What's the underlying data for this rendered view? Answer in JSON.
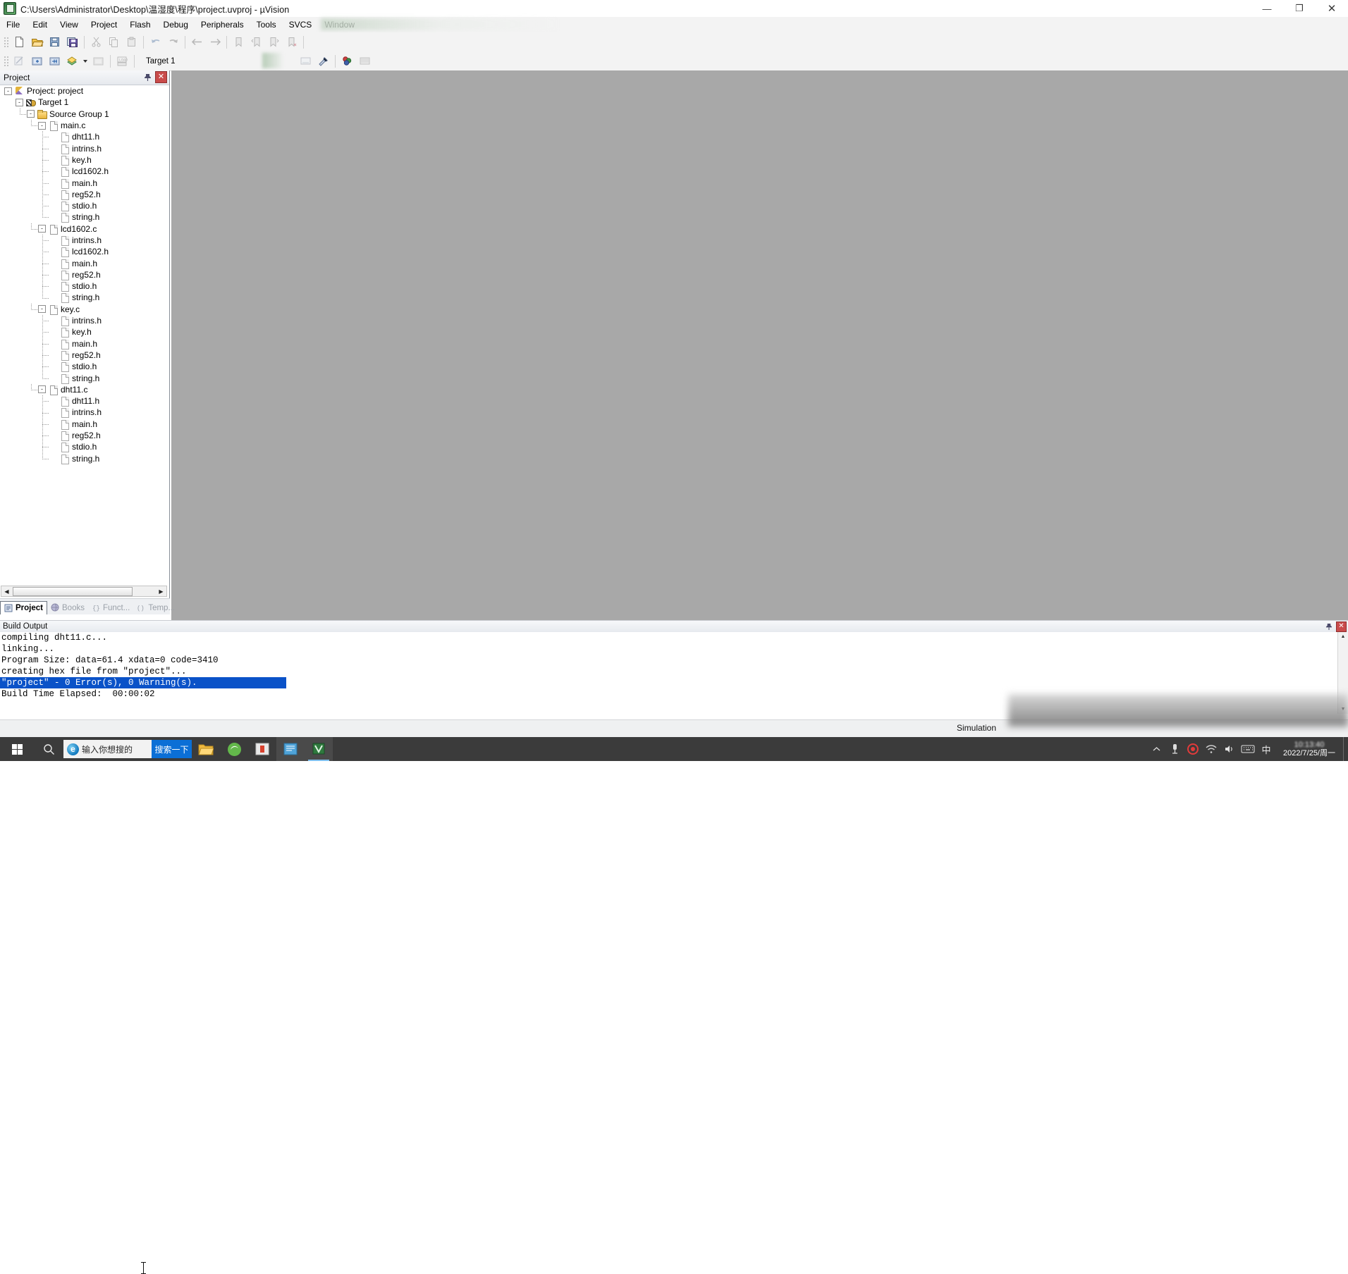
{
  "window": {
    "title": "C:\\Users\\Administrator\\Desktop\\温湿度\\程序\\project.uvproj - µVision",
    "app_icon": "keil-uvision-icon",
    "controls": {
      "minimize": "—",
      "maximize": "❐",
      "close": "✕"
    }
  },
  "menubar": {
    "items": [
      {
        "label": "File"
      },
      {
        "label": "Edit"
      },
      {
        "label": "View"
      },
      {
        "label": "Project"
      },
      {
        "label": "Flash"
      },
      {
        "label": "Debug"
      },
      {
        "label": "Peripherals"
      },
      {
        "label": "Tools"
      },
      {
        "label": "SVCS"
      },
      {
        "label": "Window"
      }
    ]
  },
  "toolbar_file": {
    "buttons": [
      {
        "name": "new-file-icon",
        "title": "New"
      },
      {
        "name": "open-file-icon",
        "title": "Open"
      },
      {
        "name": "save-icon",
        "title": "Save"
      },
      {
        "name": "save-all-icon",
        "title": "Save All"
      },
      {
        "name": "cut-icon",
        "title": "Cut"
      },
      {
        "name": "copy-icon",
        "title": "Copy"
      },
      {
        "name": "paste-icon",
        "title": "Paste"
      },
      {
        "name": "undo-icon",
        "title": "Undo"
      },
      {
        "name": "redo-icon",
        "title": "Redo"
      },
      {
        "name": "navigate-back-icon",
        "title": "Back"
      },
      {
        "name": "navigate-forward-icon",
        "title": "Forward"
      },
      {
        "name": "bookmark-toggle-icon",
        "title": "Insert/Remove Bookmark"
      },
      {
        "name": "bookmark-prev-icon",
        "title": "Previous Bookmark"
      },
      {
        "name": "bookmark-next-icon",
        "title": "Next Bookmark"
      },
      {
        "name": "bookmark-clear-icon",
        "title": "Clear All Bookmarks"
      }
    ]
  },
  "toolbar_build": {
    "buttons": [
      {
        "name": "translate-icon",
        "title": "Translate"
      },
      {
        "name": "build-icon",
        "title": "Build"
      },
      {
        "name": "rebuild-icon",
        "title": "Rebuild"
      },
      {
        "name": "batch-build-icon",
        "title": "Batch Build"
      },
      {
        "name": "stop-build-icon",
        "title": "Stop Build"
      },
      {
        "name": "download-icon",
        "title": "Download"
      }
    ],
    "target_label": "Target 1",
    "right_buttons": [
      {
        "name": "target-options-icon",
        "title": "Options for Target"
      },
      {
        "name": "configure-icon",
        "title": "Configuration Wizard"
      },
      {
        "name": "manage-components-icon",
        "title": "Manage Project Items"
      },
      {
        "name": "books-icon",
        "title": "Books"
      }
    ]
  },
  "project_panel": {
    "title": "Project",
    "pin_icon": "pin-icon",
    "close_icon": "close-icon",
    "tree": [
      {
        "level": 0,
        "label": "Project: project",
        "icon": "project-icon",
        "expander": "-"
      },
      {
        "level": 1,
        "label": "Target 1",
        "icon": "target-icon",
        "expander": "-"
      },
      {
        "level": 2,
        "label": "Source Group 1",
        "icon": "folder-icon",
        "expander": "-"
      },
      {
        "level": 3,
        "label": "main.c",
        "icon": "c-file-icon",
        "expander": "-"
      },
      {
        "level": 4,
        "label": "dht11.h",
        "icon": "header-file-icon",
        "expander": ""
      },
      {
        "level": 4,
        "label": "intrins.h",
        "icon": "header-file-icon",
        "expander": ""
      },
      {
        "level": 4,
        "label": "key.h",
        "icon": "header-file-icon",
        "expander": ""
      },
      {
        "level": 4,
        "label": "lcd1602.h",
        "icon": "header-file-icon",
        "expander": ""
      },
      {
        "level": 4,
        "label": "main.h",
        "icon": "header-file-icon",
        "expander": ""
      },
      {
        "level": 4,
        "label": "reg52.h",
        "icon": "header-file-icon",
        "expander": ""
      },
      {
        "level": 4,
        "label": "stdio.h",
        "icon": "header-file-icon",
        "expander": ""
      },
      {
        "level": 4,
        "label": "string.h",
        "icon": "header-file-icon",
        "expander": ""
      },
      {
        "level": 3,
        "label": "lcd1602.c",
        "icon": "c-file-icon",
        "expander": "-"
      },
      {
        "level": 4,
        "label": "intrins.h",
        "icon": "header-file-icon",
        "expander": ""
      },
      {
        "level": 4,
        "label": "lcd1602.h",
        "icon": "header-file-icon",
        "expander": ""
      },
      {
        "level": 4,
        "label": "main.h",
        "icon": "header-file-icon",
        "expander": ""
      },
      {
        "level": 4,
        "label": "reg52.h",
        "icon": "header-file-icon",
        "expander": ""
      },
      {
        "level": 4,
        "label": "stdio.h",
        "icon": "header-file-icon",
        "expander": ""
      },
      {
        "level": 4,
        "label": "string.h",
        "icon": "header-file-icon",
        "expander": ""
      },
      {
        "level": 3,
        "label": "key.c",
        "icon": "c-file-icon",
        "expander": "-"
      },
      {
        "level": 4,
        "label": "intrins.h",
        "icon": "header-file-icon",
        "expander": ""
      },
      {
        "level": 4,
        "label": "key.h",
        "icon": "header-file-icon",
        "expander": ""
      },
      {
        "level": 4,
        "label": "main.h",
        "icon": "header-file-icon",
        "expander": ""
      },
      {
        "level": 4,
        "label": "reg52.h",
        "icon": "header-file-icon",
        "expander": ""
      },
      {
        "level": 4,
        "label": "stdio.h",
        "icon": "header-file-icon",
        "expander": ""
      },
      {
        "level": 4,
        "label": "string.h",
        "icon": "header-file-icon",
        "expander": ""
      },
      {
        "level": 3,
        "label": "dht11.c",
        "icon": "c-file-icon",
        "expander": "-"
      },
      {
        "level": 4,
        "label": "dht11.h",
        "icon": "header-file-icon",
        "expander": ""
      },
      {
        "level": 4,
        "label": "intrins.h",
        "icon": "header-file-icon",
        "expander": ""
      },
      {
        "level": 4,
        "label": "main.h",
        "icon": "header-file-icon",
        "expander": ""
      },
      {
        "level": 4,
        "label": "reg52.h",
        "icon": "header-file-icon",
        "expander": ""
      },
      {
        "level": 4,
        "label": "stdio.h",
        "icon": "header-file-icon",
        "expander": ""
      },
      {
        "level": 4,
        "label": "string.h",
        "icon": "header-file-icon",
        "expander": ""
      }
    ],
    "tabs": [
      {
        "label": "Project",
        "icon": "project-tab-icon",
        "active": true
      },
      {
        "label": "Books",
        "icon": "books-tab-icon",
        "active": false
      },
      {
        "label": "Funct...",
        "icon": "functions-tab-icon",
        "active": false
      },
      {
        "label": "Temp...",
        "icon": "templates-tab-icon",
        "active": false
      }
    ],
    "scroll": {
      "left_arrow": "◀",
      "right_arrow": "▶"
    }
  },
  "build_output": {
    "title": "Build Output",
    "pin_icon": "pin-icon",
    "close_icon": "close-icon",
    "lines": [
      {
        "text": "compiling dht11.c...",
        "selected": false
      },
      {
        "text": "linking...",
        "selected": false
      },
      {
        "text": "Program Size: data=61.4 xdata=0 code=3410",
        "selected": false
      },
      {
        "text": "creating hex file from \"project\"...",
        "selected": false
      },
      {
        "text": "\"project\" - 0 Error(s), 0 Warning(s).",
        "selected": true
      },
      {
        "text": "Build Time Elapsed:  00:00:02",
        "selected": false
      }
    ],
    "scroll": {
      "up_arrow": "▲",
      "down_arrow": "▼"
    }
  },
  "statusbar": {
    "simulation_label": "Simulation"
  },
  "taskbar": {
    "start_icon": "windows-start-icon",
    "search_icon": "search-icon",
    "search_box": {
      "browser_icon": "internet-explorer-icon",
      "placeholder": "输入你想搜的",
      "button_label": "搜索一下"
    },
    "apps": [
      {
        "name": "file-explorer-icon",
        "label": "File Explorer"
      },
      {
        "name": "browser-icon",
        "label": "Browser"
      },
      {
        "name": "media-app-icon",
        "label": "Media"
      },
      {
        "name": "notepad-app-icon",
        "label": "Editor"
      },
      {
        "name": "keil-uvision-taskbar-icon",
        "label": "µVision"
      }
    ],
    "tray": [
      {
        "name": "show-hidden-icons-icon",
        "glyph": "^"
      },
      {
        "name": "usb-device-icon",
        "glyph": "🖴"
      },
      {
        "name": "recording-icon",
        "glyph": "◉"
      },
      {
        "name": "wifi-icon",
        "glyph": "◤"
      },
      {
        "name": "volume-icon",
        "glyph": "🔊"
      },
      {
        "name": "keyboard-ime-icon",
        "glyph": "⌨"
      },
      {
        "name": "ime-mode-icon",
        "glyph": "中"
      }
    ],
    "clock": {
      "time": "10:13:40",
      "date": "2022/7/25/周一"
    }
  },
  "colors": {
    "editor_background": "#a8a8a8",
    "selection_blue": "#0a52c8",
    "taskbar": "#3b3b3b",
    "search_button": "#0b6fd6",
    "panel_chrome": "#f3f3f3"
  }
}
